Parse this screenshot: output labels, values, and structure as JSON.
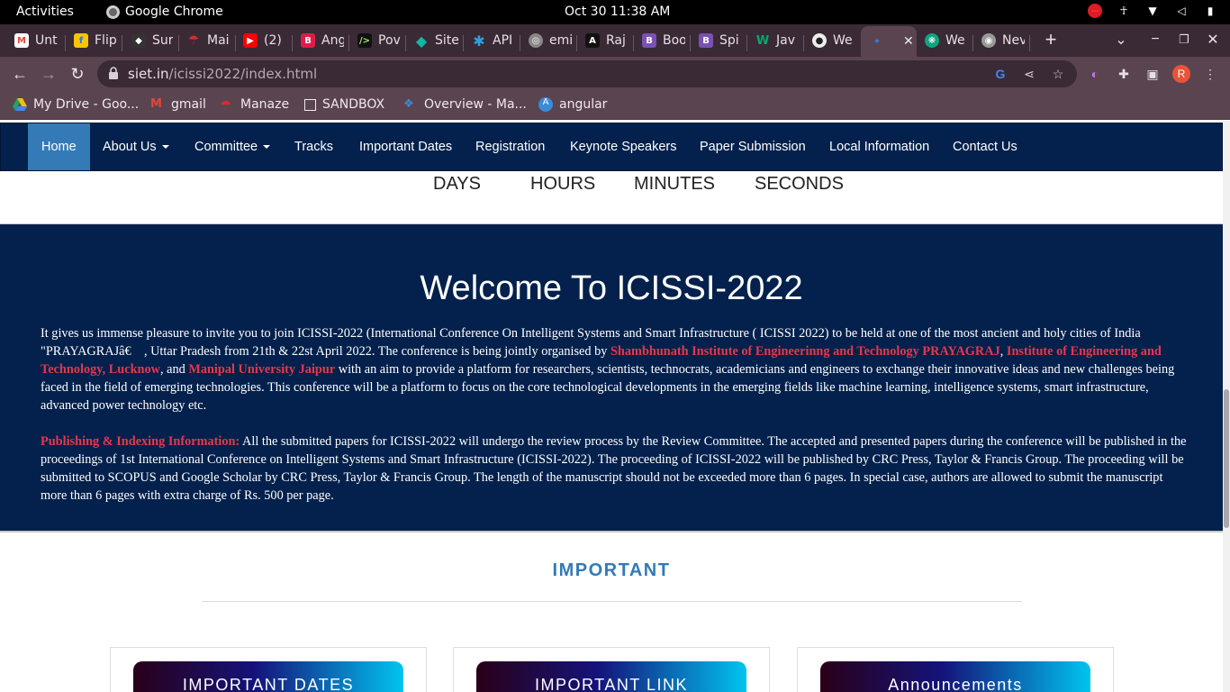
{
  "system": {
    "activities": "Activities",
    "app_name": "Google Chrome",
    "clock": "Oct 30  11:38 AM"
  },
  "tabs": [
    {
      "label": "Unt",
      "icon": "gmail-icon",
      "color": "#ea4335"
    },
    {
      "label": "Flip",
      "icon": "flipkart-icon",
      "color": "#f7c600"
    },
    {
      "label": "Sur",
      "icon": "figma-icon",
      "color": "#555555"
    },
    {
      "label": "Mai",
      "icon": "umbrella-icon",
      "color": "#d62d2d"
    },
    {
      "label": "(2)",
      "icon": "youtube-icon",
      "color": "#ff0000"
    },
    {
      "label": "Ang",
      "icon": "b-icon",
      "color": "#e01b4a"
    },
    {
      "label": "Pov",
      "icon": "terminal-icon",
      "color": "#111111"
    },
    {
      "label": "Site",
      "icon": "diamond-icon",
      "color": "#13b6a2"
    },
    {
      "label": "API",
      "icon": "snowflake-icon",
      "color": "#29a3e0"
    },
    {
      "label": "emi",
      "icon": "target-icon",
      "color": "#888888"
    },
    {
      "label": "Raj",
      "icon": "a-icon",
      "color": "#111111"
    },
    {
      "label": "Boo",
      "icon": "bootstrap-icon",
      "color": "#7952b3"
    },
    {
      "label": "Spi",
      "icon": "bootstrap-icon",
      "color": "#7952b3"
    },
    {
      "label": "Jav",
      "icon": "w-icon",
      "color": "#04aa6d"
    },
    {
      "label": "We",
      "icon": "github-icon",
      "color": "#222222"
    },
    {
      "label": "",
      "icon": "pin-icon",
      "color": "#3a7bd5"
    },
    {
      "label": "We",
      "icon": "chatgpt-icon",
      "color": "#10a37f"
    },
    {
      "label": "Nev",
      "icon": "chrome-icon",
      "color": "#999999"
    }
  ],
  "address": {
    "host": "siet.in",
    "path": "/icissi2022/index.html"
  },
  "bookmarks": [
    {
      "label": "My Drive - Goo...",
      "icon": "drive-icon"
    },
    {
      "label": "gmail",
      "icon": "gmail-icon"
    },
    {
      "label": "Manaze",
      "icon": "umbrella-icon"
    },
    {
      "label": "SANDBOX",
      "icon": "folder-icon"
    },
    {
      "label": "Overview - Ma...",
      "icon": "overview-icon"
    },
    {
      "label": "angular",
      "icon": "angular-icon"
    }
  ],
  "nav": {
    "home": "Home",
    "about": "About Us",
    "committee": "Committee",
    "tracks": "Tracks",
    "dates": "Important Dates",
    "registration": "Registration",
    "keynote": "Keynote Speakers",
    "paper": "Paper Submission",
    "local": "Local Information",
    "contact": "Contact Us"
  },
  "countdown": {
    "days": "DAYS",
    "hours": "HOURS",
    "minutes": "MINUTES",
    "seconds": "SECONDS"
  },
  "welcome": {
    "title": "Welcome To ICISSI-2022",
    "p1_a": "It gives us immense pleasure to invite you to join ICISSI-2022 (International Conference On Intelligent Systems and Smart Infrastructure ( ICISSI 2022) to be held at one of the most ancient and holy cities of India \"PRAYAGRAJâ€    , Uttar Pradesh from 21th & 22st April 2022. The conference is being jointly organised by ",
    "p1_org1": "Shambhunath Institute of Engineerinng and Technology PRAYAGRAJ",
    "p1_sep1": ", ",
    "p1_org2": "Institute of Engineering and Technology, Lucknow",
    "p1_sep2": ", and ",
    "p1_org3": "Manipal University Jaipur",
    "p1_b": " with an aim to provide a platform for researchers, scientists, technocrats, academicians and engineers to exchange their innovative ideas and new challenges being faced in the field of emerging technologies. This conference will be a platform to focus on the core technological developments in the emerging fields like machine learning, intelligence systems, smart infrastructure, advanced power technology etc.",
    "p2_label": "Publishing & Indexing Information:",
    "p2_text": " All the submitted papers for ICISSI-2022 will undergo the review process by the Review Committee. The accepted and presented papers during the conference will be published in the proceedings of 1st International Conference on Intelligent Systems and Smart Infrastructure (ICISSI-2022). The proceeding of ICISSI-2022 will be published by CRC Press, Taylor & Francis Group. The proceeding will be submitted to SCOPUS and Google Scholar by CRC Press, Taylor & Francis Group. The length of the manuscript should not be exceeded more than 6 pages. In special case, authors are allowed to submit the manuscript more than 6 pages with extra charge of Rs. 500 per page."
  },
  "important": {
    "heading": "IMPORTANT",
    "cards": [
      "IMPORTANT DATES",
      "IMPORTANT LINK",
      "Announcements"
    ]
  }
}
